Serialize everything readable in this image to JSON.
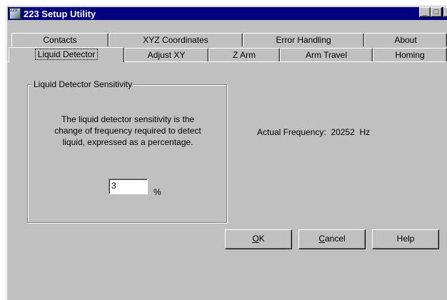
{
  "window": {
    "title": "223 Setup Utility",
    "icon_label": "223",
    "controls": {
      "minimize": "_",
      "maximize": "□",
      "close": "×"
    }
  },
  "tabs_back_row": [
    {
      "id": "contacts",
      "label": "Contacts"
    },
    {
      "id": "xyz-coordinates",
      "label": "XYZ Coordinates"
    },
    {
      "id": "error-handling",
      "label": "Error Handling"
    },
    {
      "id": "about",
      "label": "About"
    }
  ],
  "tabs_front_row": [
    {
      "id": "liquid-detector",
      "label": "Liquid Detector",
      "selected": true
    },
    {
      "id": "adjust-xy",
      "label": "Adjust XY"
    },
    {
      "id": "z-arm",
      "label": "Z Arm"
    },
    {
      "id": "arm-travel",
      "label": "Arm Travel"
    },
    {
      "id": "homing",
      "label": "Homing"
    }
  ],
  "sensitivity_group": {
    "title": "Liquid Detector Sensitivity",
    "description_lines": [
      "The liquid detector sensitivity is the",
      "change of frequency required to detect",
      "liquid, expressed as a percentage."
    ],
    "value": "3",
    "unit": "%"
  },
  "frequency": {
    "label": "Actual Frequency:",
    "value": "20252",
    "unit": "Hz"
  },
  "buttons": {
    "ok": {
      "mnemonic": "O",
      "rest": "K"
    },
    "cancel": {
      "mnemonic": "C",
      "rest": "ancel"
    },
    "help": {
      "label": "Help"
    }
  },
  "colors": {
    "face": "#c0c0c0",
    "titlebar": "#000080",
    "shadow": "#808080",
    "highlight": "#ffffff"
  }
}
